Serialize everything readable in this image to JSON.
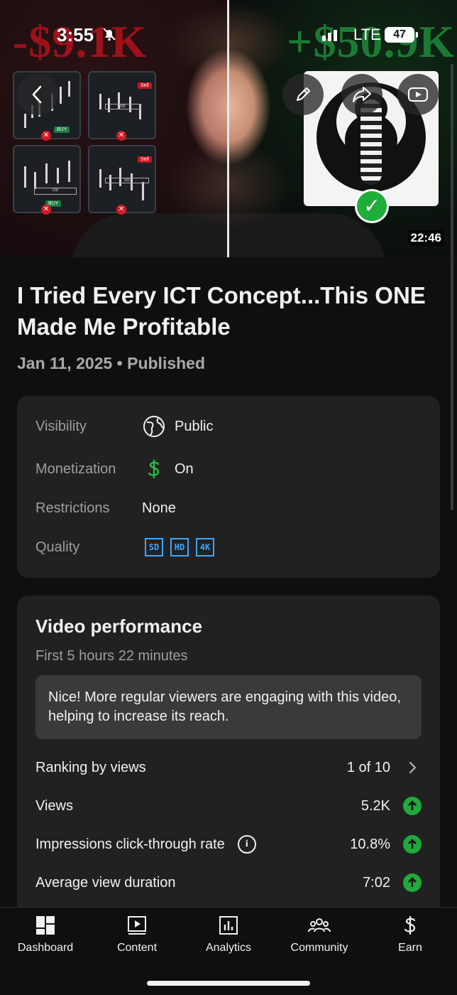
{
  "status_bar": {
    "time": "3:55",
    "network": "LTE",
    "battery": "47"
  },
  "thumbnail": {
    "left_overlay": "-$9.1K",
    "right_overlay": "+$50.9K",
    "duration": "22:46",
    "chart_tags": [
      "BUY",
      "Sell",
      "OB",
      "BUY",
      "Sell",
      "BB",
      "BB"
    ]
  },
  "video": {
    "title": "I Tried Every ICT Concept...This ONE Made Me Profitable",
    "date_status": "Jan 11, 2025 • Published"
  },
  "info": {
    "visibility_label": "Visibility",
    "visibility_value": "Public",
    "monetization_label": "Monetization",
    "monetization_value": "On",
    "restrictions_label": "Restrictions",
    "restrictions_value": "None",
    "quality_label": "Quality",
    "quality_badges": [
      "SD",
      "HD",
      "4K"
    ]
  },
  "performance": {
    "title": "Video performance",
    "subtitle": "First 5 hours 22 minutes",
    "callout": "Nice! More regular viewers are engaging with this video, helping to increase its reach.",
    "rows": [
      {
        "label": "Ranking by views",
        "value": "1 of 10"
      },
      {
        "label": "Views",
        "value": "5.2K"
      },
      {
        "label": "Impressions click-through rate",
        "value": "10.8%"
      },
      {
        "label": "Average view duration",
        "value": "7:02"
      }
    ]
  },
  "nav": [
    {
      "label": "Dashboard",
      "icon": "dashboard-icon"
    },
    {
      "label": "Content",
      "icon": "content-icon"
    },
    {
      "label": "Analytics",
      "icon": "analytics-icon"
    },
    {
      "label": "Community",
      "icon": "community-icon"
    },
    {
      "label": "Earn",
      "icon": "earn-icon"
    }
  ],
  "colors": {
    "accent_blue": "#3ea6ff",
    "success_green": "#1faa3a",
    "money_green": "#2bb84a"
  }
}
